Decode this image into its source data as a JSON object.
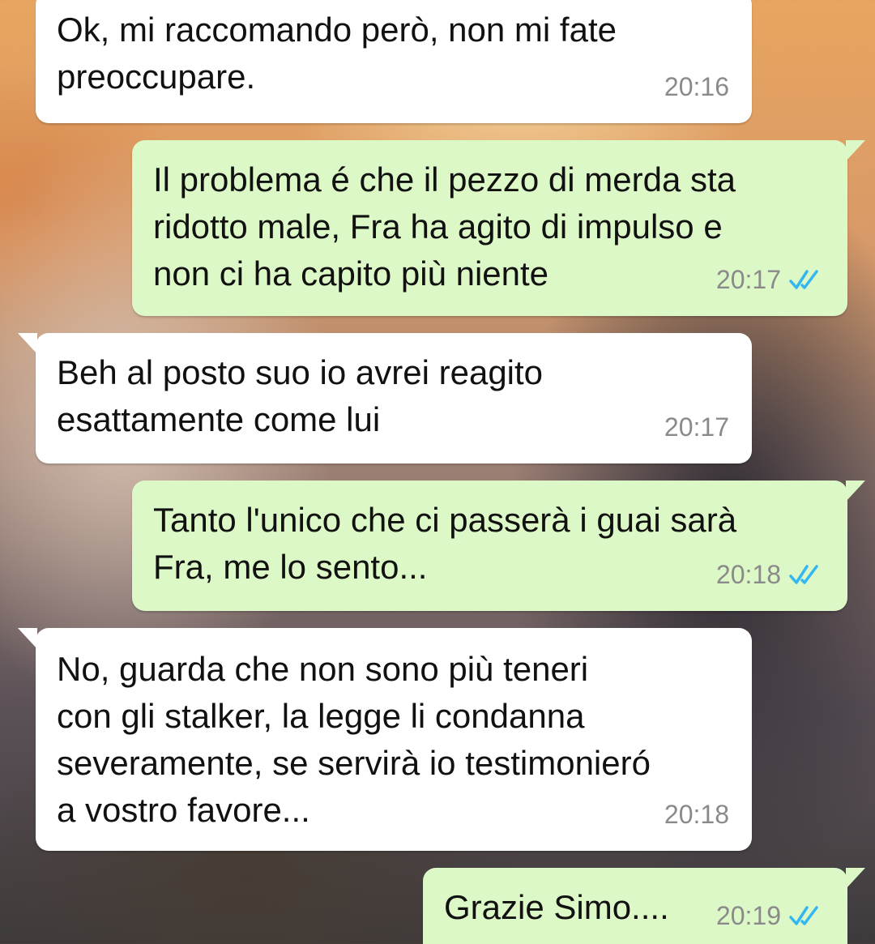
{
  "messages": [
    {
      "direction": "incoming",
      "text": "Ok, mi raccomando però, non mi fate\npreoccupare.",
      "time": "20:16"
    },
    {
      "direction": "outgoing",
      "text": "Il problema é che il pezzo di merda sta\nridotto male, Fra ha agito di impulso e\nnon ci ha capito più niente",
      "time": "20:17",
      "status": "read"
    },
    {
      "direction": "incoming",
      "text": "Beh al posto suo io avrei reagito\nesattamente come lui",
      "time": "20:17"
    },
    {
      "direction": "outgoing",
      "text": "Tanto l'unico che ci passerà i guai sarà\nFra, me lo sento...",
      "time": "20:18",
      "status": "read"
    },
    {
      "direction": "incoming",
      "text": "No, guarda che non sono più teneri\ncon gli stalker, la legge li condanna\nseveramente, se servirà io testimonieró\na vostro favore...",
      "time": "20:18"
    },
    {
      "direction": "outgoing",
      "text": "Grazie Simo....",
      "time": "20:19",
      "status": "read"
    }
  ],
  "colors": {
    "incoming_bubble": "#ffffff",
    "outgoing_bubble": "#dcf8c6",
    "read_check": "#34b7f1",
    "timestamp": "#8a8a8a"
  },
  "icons": {
    "read_receipt": "double-check-icon"
  }
}
